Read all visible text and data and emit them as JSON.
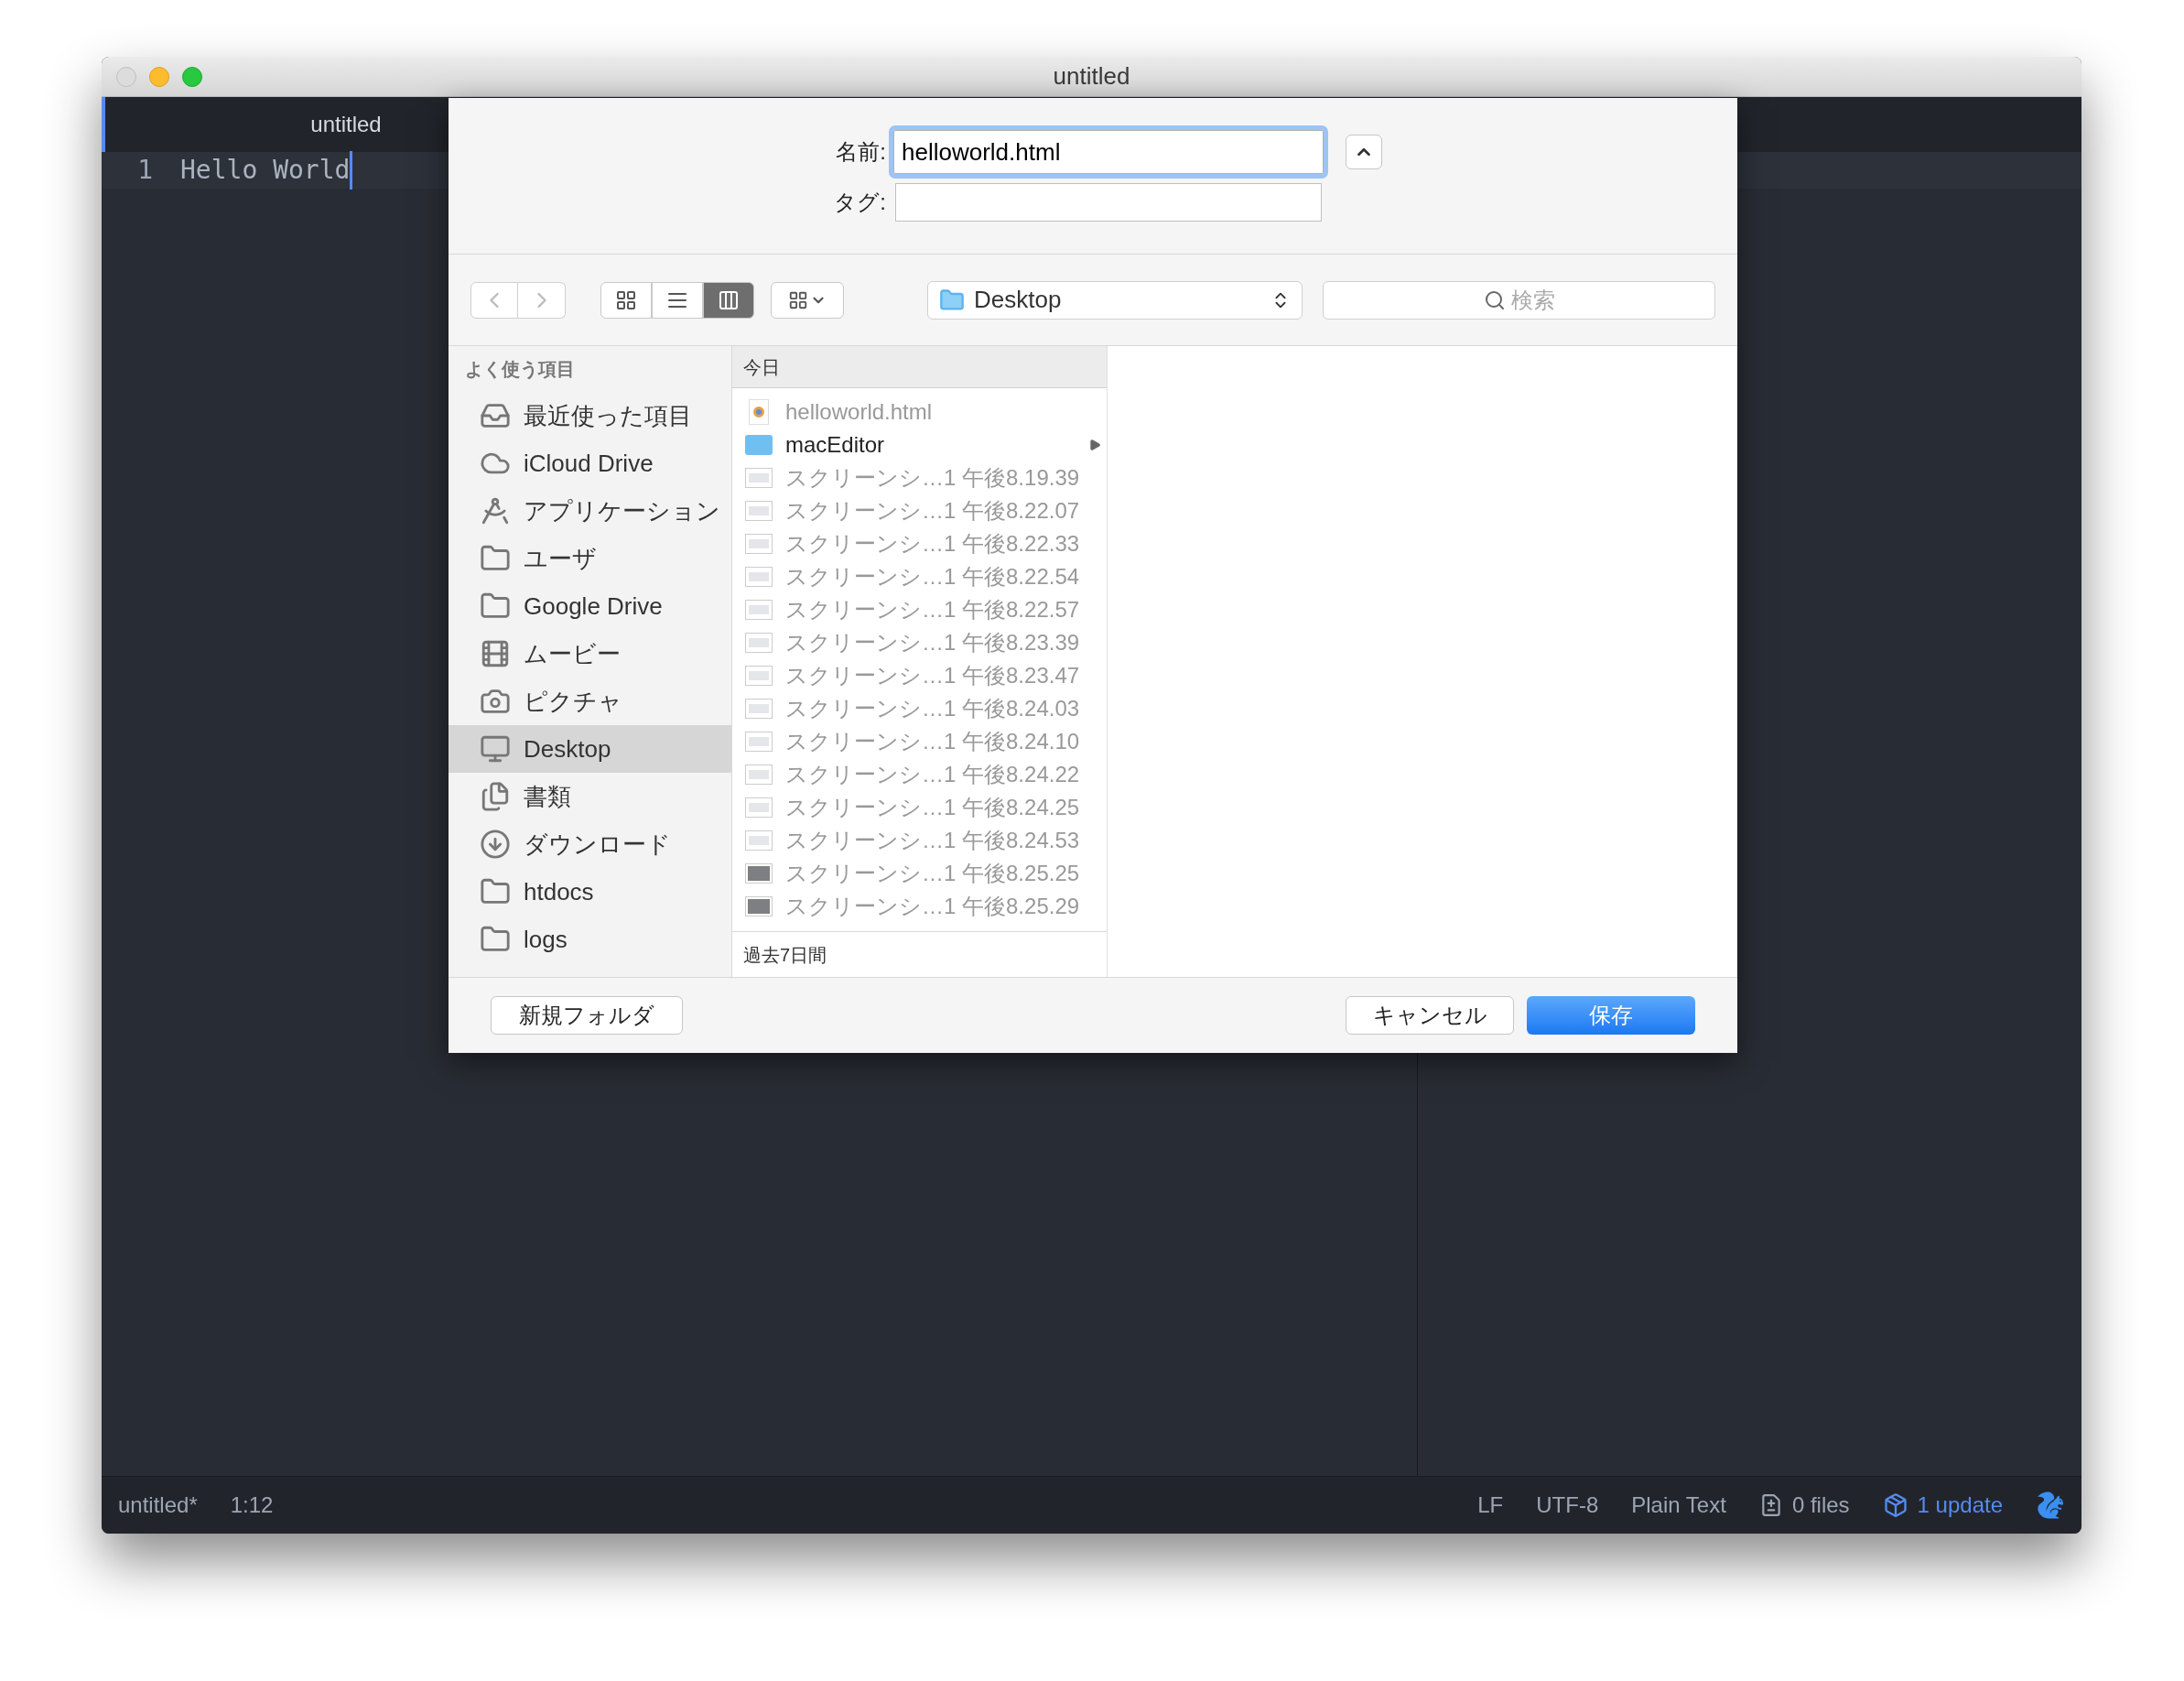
{
  "window": {
    "title": "untitled"
  },
  "editor": {
    "tab": "untitled",
    "lines": [
      {
        "number": "1",
        "text": "Hello World"
      }
    ]
  },
  "save_dialog": {
    "name_label": "名前:",
    "name_value": "helloworld.html",
    "tags_label": "タグ:",
    "view_modes": [
      {
        "kind": "icons",
        "selected": false
      },
      {
        "kind": "list",
        "selected": false
      },
      {
        "kind": "columns",
        "selected": true
      }
    ],
    "location": "Desktop",
    "search": {
      "placeholder": "検索"
    },
    "sidebar": {
      "header": "よく使う項目",
      "items": [
        {
          "label": "最近使った項目",
          "kind": "recent",
          "selected": false
        },
        {
          "label": "iCloud Drive",
          "kind": "cloud",
          "selected": false
        },
        {
          "label": "アプリケーション",
          "kind": "apps",
          "selected": false
        },
        {
          "label": "ユーザ",
          "kind": "folder",
          "selected": false
        },
        {
          "label": "Google Drive",
          "kind": "folder",
          "selected": false
        },
        {
          "label": "ムービー",
          "kind": "movie",
          "selected": false
        },
        {
          "label": "ピクチャ",
          "kind": "camera",
          "selected": false
        },
        {
          "label": "Desktop",
          "kind": "desktop",
          "selected": true
        },
        {
          "label": "書類",
          "kind": "documents",
          "selected": false
        },
        {
          "label": "ダウンロード",
          "kind": "download",
          "selected": false
        },
        {
          "label": "htdocs",
          "kind": "folder",
          "selected": false
        },
        {
          "label": "logs",
          "kind": "folder",
          "selected": false
        }
      ]
    },
    "column": {
      "header": "今日",
      "footer": "過去7日間",
      "items": [
        {
          "name": "helloworld.html",
          "kind": "html",
          "disabled": true
        },
        {
          "name": "macEditor",
          "kind": "folder",
          "disabled": false
        },
        {
          "name": "スクリーンシ…1 午後8.19.39",
          "kind": "image",
          "disabled": true
        },
        {
          "name": "スクリーンシ…1 午後8.22.07",
          "kind": "image",
          "disabled": true
        },
        {
          "name": "スクリーンシ…1 午後8.22.33",
          "kind": "image",
          "disabled": true
        },
        {
          "name": "スクリーンシ…1 午後8.22.54",
          "kind": "image",
          "disabled": true
        },
        {
          "name": "スクリーンシ…1 午後8.22.57",
          "kind": "image",
          "disabled": true
        },
        {
          "name": "スクリーンシ…1 午後8.23.39",
          "kind": "image",
          "disabled": true
        },
        {
          "name": "スクリーンシ…1 午後8.23.47",
          "kind": "image",
          "disabled": true
        },
        {
          "name": "スクリーンシ…1 午後8.24.03",
          "kind": "image",
          "disabled": true
        },
        {
          "name": "スクリーンシ…1 午後8.24.10",
          "kind": "image",
          "disabled": true
        },
        {
          "name": "スクリーンシ…1 午後8.24.22",
          "kind": "image",
          "disabled": true
        },
        {
          "name": "スクリーンシ…1 午後8.24.25",
          "kind": "image",
          "disabled": true
        },
        {
          "name": "スクリーンシ…1 午後8.24.53",
          "kind": "image",
          "disabled": true
        },
        {
          "name": "スクリーンシ…1 午後8.25.25",
          "kind": "dark-image",
          "disabled": true
        },
        {
          "name": "スクリーンシ…1 午後8.25.29",
          "kind": "dark-image",
          "disabled": true
        }
      ]
    },
    "buttons": {
      "new_folder": "新規フォルダ",
      "cancel": "キャンセル",
      "save": "保存"
    }
  },
  "status_bar": {
    "file": "untitled*",
    "cursor": "1:12",
    "line_ending": "LF",
    "encoding": "UTF-8",
    "grammar": "Plain Text",
    "files": "0 files",
    "updates": "1 update"
  }
}
